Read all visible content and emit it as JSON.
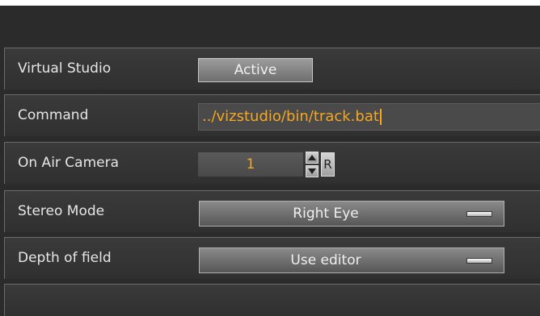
{
  "rows": {
    "virtual_studio": {
      "label": "Virtual Studio",
      "button": "Active"
    },
    "command": {
      "label": "Command",
      "value": "../vizstudio/bin/track.bat"
    },
    "on_air_camera": {
      "label": "On Air Camera",
      "value": "1",
      "reset_label": "R"
    },
    "stereo_mode": {
      "label": "Stereo Mode",
      "value": "Right Eye"
    },
    "depth_of_field": {
      "label": "Depth of field",
      "value": "Use editor"
    }
  },
  "colors": {
    "value_text": "#f5a623",
    "panel_bg": "#2b2b2b"
  },
  "icons": {
    "stepper_up": "triangle-up-icon",
    "stepper_down": "triangle-down-icon",
    "dropdown": "dropdown-bar-icon"
  }
}
